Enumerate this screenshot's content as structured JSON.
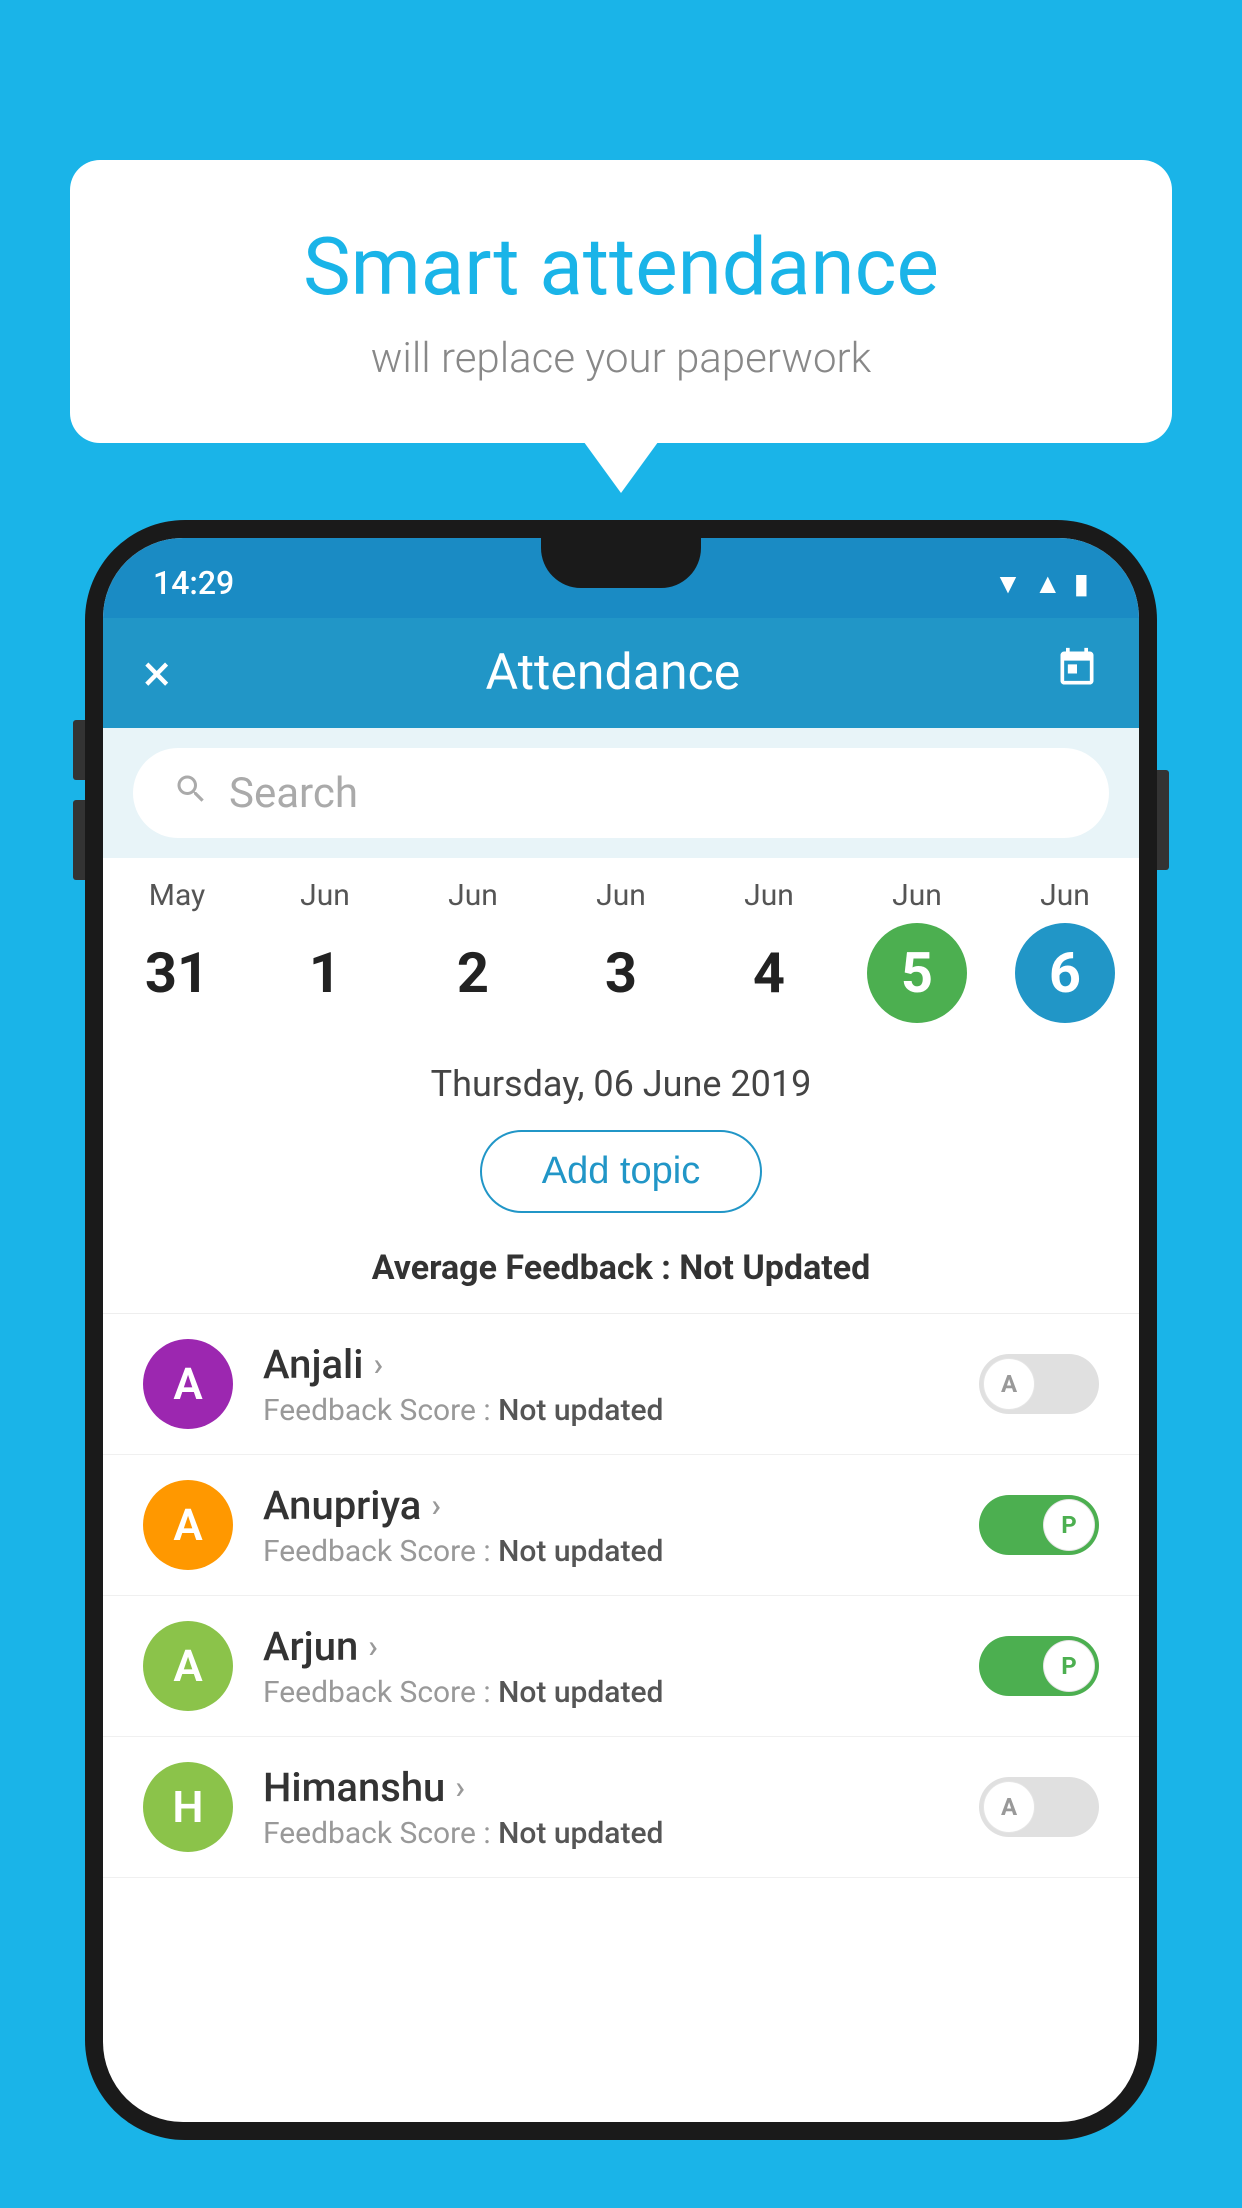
{
  "background_color": "#1ab4e8",
  "speech_bubble": {
    "title": "Smart attendance",
    "subtitle": "will replace your paperwork"
  },
  "status_bar": {
    "time": "14:29",
    "icons": [
      "wifi",
      "signal",
      "battery"
    ]
  },
  "header": {
    "title": "Attendance",
    "close_label": "×",
    "calendar_icon": "📅"
  },
  "search": {
    "placeholder": "Search"
  },
  "calendar": {
    "days": [
      {
        "month": "May",
        "date": "31",
        "style": "normal"
      },
      {
        "month": "Jun",
        "date": "1",
        "style": "normal"
      },
      {
        "month": "Jun",
        "date": "2",
        "style": "normal"
      },
      {
        "month": "Jun",
        "date": "3",
        "style": "normal"
      },
      {
        "month": "Jun",
        "date": "4",
        "style": "normal"
      },
      {
        "month": "Jun",
        "date": "5",
        "style": "today"
      },
      {
        "month": "Jun",
        "date": "6",
        "style": "selected"
      }
    ]
  },
  "selected_date": "Thursday, 06 June 2019",
  "add_topic_label": "Add topic",
  "avg_feedback_label": "Average Feedback :",
  "avg_feedback_value": "Not Updated",
  "students": [
    {
      "name": "Anjali",
      "avatar_letter": "A",
      "avatar_color": "#9c27b0",
      "feedback_label": "Feedback Score :",
      "feedback_value": "Not updated",
      "attendance": "absent",
      "toggle_label": "A"
    },
    {
      "name": "Anupriya",
      "avatar_letter": "A",
      "avatar_color": "#ff9800",
      "feedback_label": "Feedback Score :",
      "feedback_value": "Not updated",
      "attendance": "present",
      "toggle_label": "P"
    },
    {
      "name": "Arjun",
      "avatar_letter": "A",
      "avatar_color": "#8bc34a",
      "feedback_label": "Feedback Score :",
      "feedback_value": "Not updated",
      "attendance": "present",
      "toggle_label": "P"
    },
    {
      "name": "Himanshu",
      "avatar_letter": "H",
      "avatar_color": "#8bc34a",
      "feedback_label": "Feedback Score :",
      "feedback_value": "Not updated",
      "attendance": "absent",
      "toggle_label": "A"
    }
  ]
}
